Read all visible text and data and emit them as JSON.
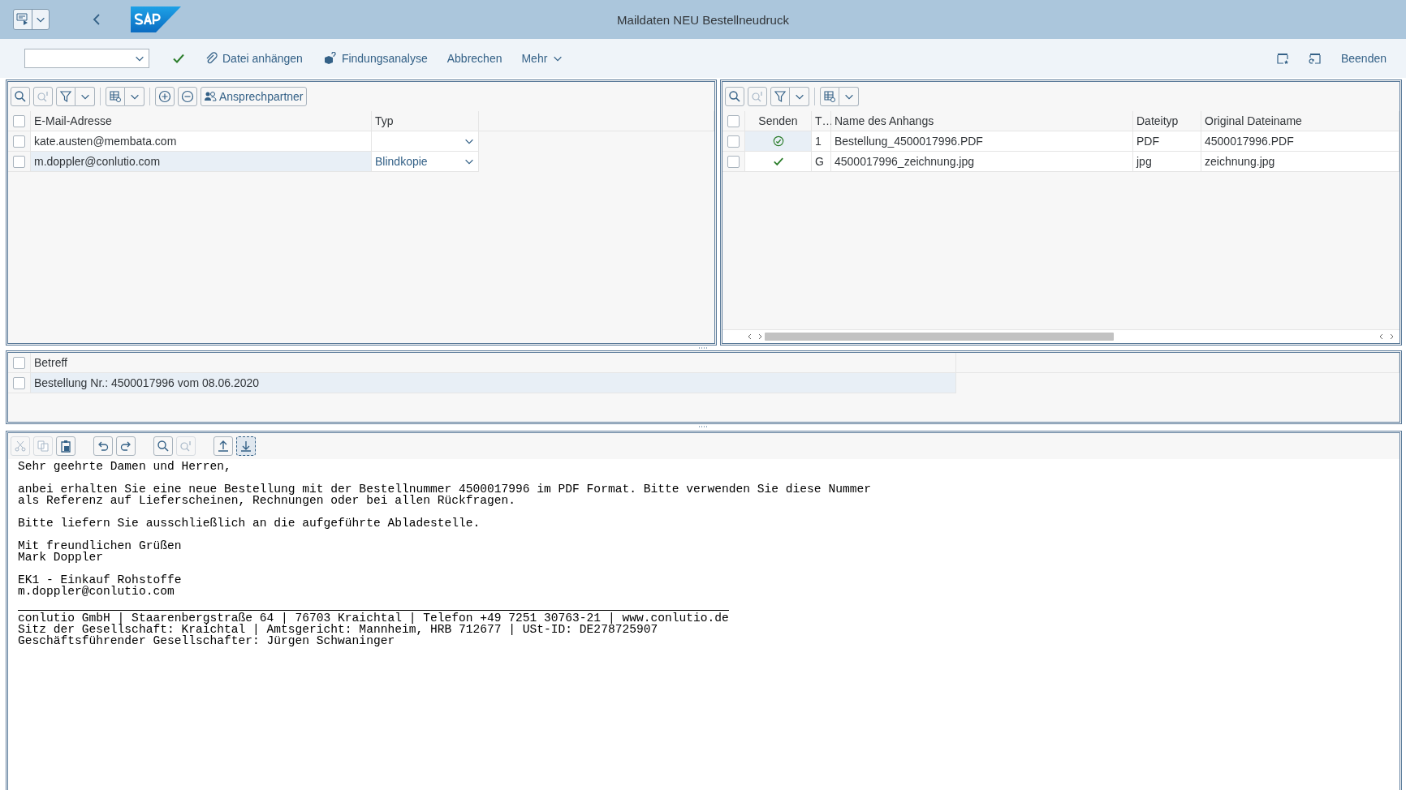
{
  "shell": {
    "title": "Maildaten NEU Bestellneudruck"
  },
  "toolbar": {
    "actions": [
      {
        "kind": "check"
      },
      {
        "kind": "attach",
        "label": "Datei anhängen"
      },
      {
        "kind": "analysis",
        "label": "Findungsanalyse"
      },
      {
        "kind": "plain",
        "label": "Abbrechen"
      },
      {
        "kind": "menu",
        "label": "Mehr"
      }
    ],
    "right_actions": [
      {
        "kind": "favorite"
      },
      {
        "kind": "restore"
      },
      {
        "kind": "plain",
        "label": "Beenden"
      }
    ]
  },
  "recipients": {
    "contact_button": "Ansprechpartner",
    "all_checked": false,
    "columns": [
      "E-Mail-Adresse",
      "Typ"
    ],
    "rows": [
      {
        "email": "kate.austen@membata.com",
        "checked": false,
        "selected": false
      },
      {
        "email": "m.doppler@conlutio.com",
        "type": "Blindkopie",
        "checked": false,
        "selected": true
      }
    ]
  },
  "attachments": {
    "all_checked": false,
    "columns": [
      "Senden",
      "T…",
      "Name des Anhangs",
      "Dateityp",
      "Original Dateiname"
    ],
    "rows": [
      {
        "send_circled": true,
        "checked": false,
        "selected": true,
        "type": "1",
        "name": "Bestellung_4500017996.PDF",
        "filetype": "PDF",
        "original": "4500017996.PDF"
      },
      {
        "send_circled": false,
        "checked": false,
        "selected": false,
        "type": "G",
        "name": "4500017996_zeichnung.jpg",
        "filetype": "jpg",
        "original": "zeichnung.jpg"
      }
    ]
  },
  "subject": {
    "column": "Betreff",
    "all_checked": false,
    "rows": [
      {
        "text": "Bestellung Nr.: 4500017996 vom 08.06.2020",
        "checked": false,
        "selected": true
      }
    ]
  },
  "editor": {
    "paragraphs": [
      [
        "Sehr geehrte Damen und Herren,"
      ],
      [
        "anbei erhalten Sie eine neue Bestellung mit der Bestellnummer 4500017996 im PDF Format. Bitte verwenden Sie diese Nummer",
        "als Referenz auf Lieferscheinen, Rechnungen oder bei allen Rückfragen."
      ],
      [
        "Bitte liefern Sie ausschließlich an die aufgeführte Abladestelle."
      ],
      [
        "Mit freundlichen Grüßen",
        "Mark Doppler"
      ],
      [
        "EK1 - Einkauf Rohstoffe",
        "m.doppler@conlutio.com"
      ]
    ],
    "signature": [
      "conlutio GmbH | Staarenbergstraße 64 | 76703 Kraichtal | Telefon +49 7251 30763-21 | www.conlutio.de",
      "Sitz der Gesellschaft: Kraichtal | Amtsgericht: Mannheim, HRB 712677 | USt-ID: DE278725907",
      "Geschäftsführender Gesellschafter: Jürgen Schwaninger"
    ]
  }
}
